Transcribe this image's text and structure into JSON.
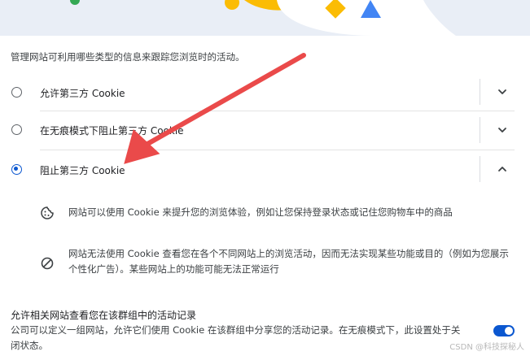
{
  "subtitle": "管理网站可利用哪些类型的信息来跟踪您浏览时的活动。",
  "options": [
    {
      "label": "允许第三方 Cookie",
      "selected": false,
      "expanded": false
    },
    {
      "label": "在无痕模式下阻止第三方 Cookie",
      "selected": false,
      "expanded": false
    },
    {
      "label": "阻止第三方 Cookie",
      "selected": true,
      "expanded": true
    }
  ],
  "details": [
    {
      "icon": "cookie-icon",
      "text": "网站可以使用 Cookie 来提升您的浏览体验，例如让您保持登录状态或记住您购物车中的商品"
    },
    {
      "icon": "block-icon",
      "text": "网站无法使用 Cookie 查看您在各个不同网站上的浏览活动，因而无法实现某些功能或目的（例如为您展示个性化广告）。某些网站上的功能可能无法正常运行"
    }
  ],
  "related_sites": {
    "title": "允许相关网站查看您在该群组中的活动记录",
    "description": "公司可以定义一组网站，允许它们使用 Cookie 在该群组中分享您的活动记录。在无痕模式下，此设置处于关闭状态。",
    "toggle_on": true
  },
  "watermark": "CSDN @科技探秘人",
  "colors": {
    "accent": "#0b57d0",
    "annotation_arrow": "#ea4a4a",
    "banner_bg": "#e9eef6",
    "illustration_yellow": "#fbbc04",
    "illustration_blue": "#4285f4"
  }
}
